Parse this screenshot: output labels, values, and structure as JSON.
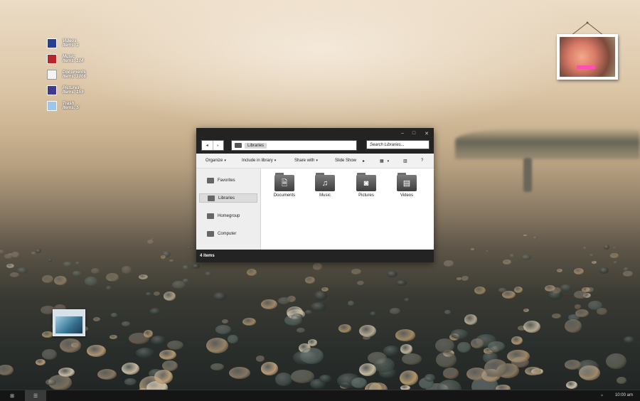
{
  "desktop": {
    "icons": [
      {
        "name": "Videos",
        "meta": "Items: 1",
        "icon": "videos-icon"
      },
      {
        "name": "Music",
        "meta": "Items: 104",
        "icon": "music-icon"
      },
      {
        "name": "Documents",
        "meta": "Items: 1008",
        "icon": "documents-icon"
      },
      {
        "name": "Pictures",
        "meta": "Items: 159",
        "icon": "pictures-icon"
      },
      {
        "name": "Trash",
        "meta": "Items: 5",
        "icon": "trash-icon"
      }
    ]
  },
  "window": {
    "controls": {
      "minimize": "–",
      "maximize": "□",
      "close": "✕"
    },
    "nav": {
      "back": "◂",
      "forward": "▸"
    },
    "address": {
      "crumb": "Libraries"
    },
    "search": {
      "placeholder": "Search Libraries..."
    },
    "toolbar": {
      "organize": "Organize",
      "include": "Include in library",
      "share": "Share with",
      "slideshow": "Slide Show",
      "more": "▸",
      "view": "▦",
      "view_caret": "▾",
      "pane": "▥",
      "help": "?",
      "caret": "▾"
    },
    "sidebar": [
      {
        "label": "Favorites",
        "selected": false
      },
      {
        "label": "Libraries",
        "selected": true
      },
      {
        "label": "Homegroup",
        "selected": false
      },
      {
        "label": "Computer",
        "selected": false
      }
    ],
    "libraries": [
      {
        "label": "Documents",
        "glyph": "🗎",
        "icon": "documents-folder-icon"
      },
      {
        "label": "Music",
        "glyph": "♫",
        "icon": "music-folder-icon"
      },
      {
        "label": "Pictures",
        "glyph": "◙",
        "icon": "pictures-folder-icon"
      },
      {
        "label": "Videos",
        "glyph": "▤",
        "icon": "videos-folder-icon"
      }
    ],
    "status": "4 items"
  },
  "taskbar": {
    "start_glyph": "⊞",
    "app_glyph": "☰",
    "tray": "▵",
    "clock": "10:00 am"
  },
  "colors": {
    "titlebar": "#232323",
    "sidebar": "#eeeeee",
    "taskbar": "#151515"
  }
}
